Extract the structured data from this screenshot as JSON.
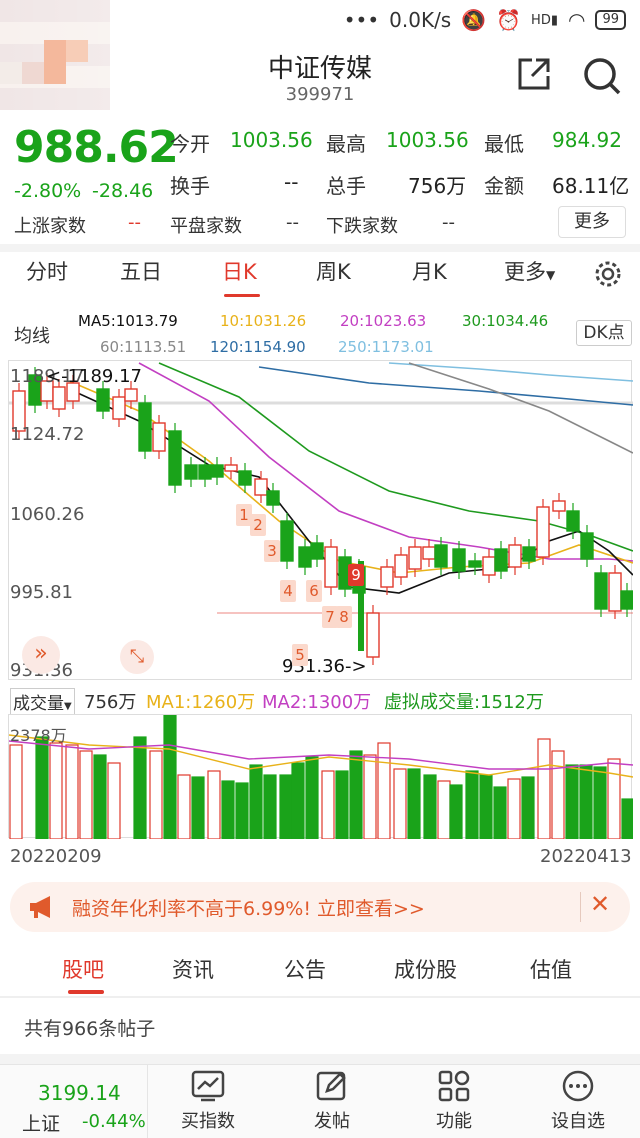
{
  "status_bar": {
    "network_speed": "0.0K/s",
    "battery": "99",
    "icons": [
      "mute-icon",
      "alarm-icon",
      "hd-signal-icon",
      "wifi-icon",
      "battery-icon"
    ]
  },
  "header": {
    "title": "中证传媒",
    "code": "399971",
    "share_icon": "share-icon",
    "search_icon": "search-icon"
  },
  "quote": {
    "price": "988.62",
    "change_pct": "-2.80%",
    "change_abs": "-28.46",
    "stats": [
      {
        "label": "今开",
        "value": "1003.56"
      },
      {
        "label": "最高",
        "value": "1003.56"
      },
      {
        "label": "最低",
        "value": "984.92"
      },
      {
        "label": "换手",
        "value": "--"
      },
      {
        "label": "总手",
        "value": "756万"
      },
      {
        "label": "金额",
        "value": "68.11亿"
      }
    ],
    "breadth": [
      {
        "label": "上涨家数",
        "value": "--"
      },
      {
        "label": "平盘家数",
        "value": "--"
      },
      {
        "label": "下跌家数",
        "value": "--"
      }
    ],
    "more_label": "更多"
  },
  "period_tabs": {
    "items": [
      "分时",
      "五日",
      "日K",
      "周K",
      "月K",
      "更多"
    ],
    "active": 2,
    "settings_icon": "gear-icon"
  },
  "ma_legend": {
    "label": "均线",
    "ma5": "MA5:1013.79",
    "ma10": "10:1031.26",
    "ma20": "20:1023.63",
    "ma30": "30:1034.46",
    "ma60": "60:1113.51",
    "ma120": "120:1154.90",
    "ma250": "250:1173.01",
    "dk_label": "DK点",
    "colors": {
      "ma5": "#111111",
      "ma10": "#e8b21a",
      "ma20": "#c23fc2",
      "ma30": "#1f9a1f",
      "ma60": "#888888",
      "ma120": "#2e6da4",
      "ma250": "#7fbfe0"
    }
  },
  "kline": {
    "y_labels": [
      "1189.17",
      "1124.72",
      "1060.26",
      "995.81",
      "931.36"
    ],
    "high_marker": "<-1189.17",
    "low_marker": "931.36->",
    "dk_numbers": [
      "1",
      "2",
      "3",
      "4",
      "5",
      "6",
      "7",
      "8",
      "9"
    ]
  },
  "volume": {
    "label": "成交量",
    "value": "756万",
    "ma1": "MA1:1260万",
    "ma2": "MA2:1300万",
    "virtual": "虚拟成交量:1512万",
    "top_label": "2378万",
    "date_start": "20220209",
    "date_end": "20220413"
  },
  "banner": {
    "text": "融资年化利率不高于6.99%! 立即查看>>",
    "icon": "megaphone-icon",
    "close_icon": "close-icon"
  },
  "sub_tabs": {
    "items": [
      "股吧",
      "资讯",
      "公告",
      "成份股",
      "估值"
    ],
    "active": 0
  },
  "post_count": "共有966条帖子",
  "bottom_bar": {
    "index_value": "3199.14",
    "index_name": "上证",
    "index_change": "-0.44%",
    "items": [
      "买指数",
      "发帖",
      "功能",
      "设自选"
    ]
  }
}
